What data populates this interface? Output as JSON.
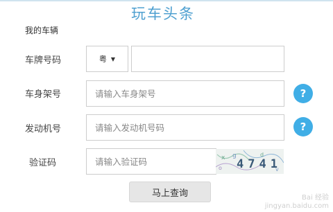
{
  "app_title": "玩车头条",
  "section_title": "我的车辆",
  "form": {
    "plate": {
      "label": "车牌号码",
      "province_value": "粤",
      "number_value": "",
      "number_placeholder": ""
    },
    "frame": {
      "label": "车身架号",
      "placeholder": "请输入车身架号",
      "help_icon": "question-circle-icon"
    },
    "engine": {
      "label": "发动机号",
      "placeholder": "请输入发动机号码",
      "help_icon": "question-circle-icon"
    },
    "captcha": {
      "label": "验证码",
      "placeholder": "请输入验证码",
      "image_text": "4741"
    },
    "submit_label": "马上查询"
  },
  "watermark": {
    "line1": "Bai 经验",
    "line2": "jingyan.baidu.com"
  },
  "colors": {
    "accent": "#40aee6",
    "title": "#4fa0d0",
    "border": "#cccccc"
  }
}
